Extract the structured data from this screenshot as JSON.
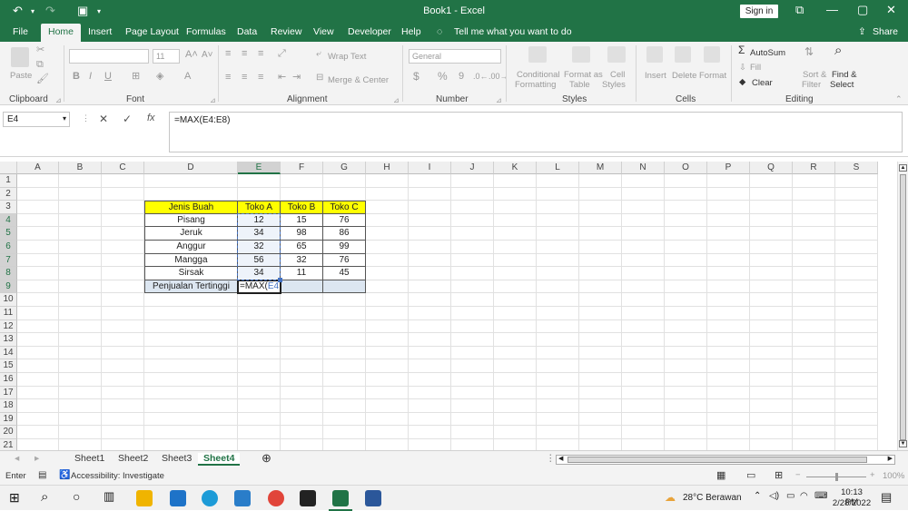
{
  "window": {
    "title": "Book1 - Excel",
    "signin": "Sign in"
  },
  "tabs": [
    "File",
    "Home",
    "Insert",
    "Page Layout",
    "Formulas",
    "Data",
    "Review",
    "View",
    "Developer",
    "Help"
  ],
  "tell_me": "Tell me what you want to do",
  "share": "Share",
  "ribbon": {
    "clipboard": {
      "label": "Clipboard",
      "paste": "Paste"
    },
    "font": {
      "label": "Font",
      "size": "11"
    },
    "alignment": {
      "label": "Alignment",
      "wrap": "Wrap Text",
      "merge": "Merge & Center"
    },
    "number": {
      "label": "Number",
      "format": "General"
    },
    "styles": {
      "label": "Styles",
      "conditional1": "Conditional",
      "conditional2": "Formatting",
      "format_as1": "Format as",
      "format_as2": "Table",
      "cell1": "Cell",
      "cell2": "Styles"
    },
    "cells": {
      "label": "Cells",
      "insert": "Insert",
      "delete": "Delete",
      "format": "Format"
    },
    "editing": {
      "label": "Editing",
      "autosum": "AutoSum",
      "fill": "Fill",
      "clear": "Clear",
      "sort1": "Sort &",
      "sort2": "Filter",
      "find1": "Find &",
      "find2": "Select"
    }
  },
  "formula_bar": {
    "name_box": "E4",
    "formula": "=MAX(E4:E8)"
  },
  "columns": [
    "A",
    "B",
    "C",
    "D",
    "E",
    "F",
    "G",
    "H",
    "I",
    "J",
    "K",
    "L",
    "M",
    "N",
    "O",
    "P",
    "Q",
    "R",
    "S"
  ],
  "rows": [
    "1",
    "2",
    "3",
    "4",
    "5",
    "6",
    "7",
    "8",
    "9",
    "10",
    "11",
    "12",
    "13",
    "14",
    "15",
    "16",
    "17",
    "18",
    "19",
    "20",
    "21"
  ],
  "table": {
    "headers": [
      "Jenis Buah",
      "Toko A",
      "Toko B",
      "Toko C"
    ],
    "rows": [
      [
        "Pisang",
        "12",
        "15",
        "76"
      ],
      [
        "Jeruk",
        "34",
        "98",
        "86"
      ],
      [
        "Anggur",
        "32",
        "65",
        "99"
      ],
      [
        "Mangga",
        "56",
        "32",
        "76"
      ],
      [
        "Sirsak",
        "34",
        "11",
        "45"
      ]
    ],
    "footer_label": "Penjualan Tertinggi",
    "footer_prefix": "=MAX(",
    "footer_ref": "E4:E8",
    "footer_suffix": ")"
  },
  "sheets": [
    "Sheet1",
    "Sheet2",
    "Sheet3",
    "Sheet4"
  ],
  "status": {
    "mode": "Enter",
    "accessibility": "Accessibility: Investigate",
    "zoom": "100%"
  },
  "taskbar": {
    "weather": "28°C  Berawan",
    "time": "10:13 PM",
    "date": "2/28/2022"
  },
  "colors": {
    "excel_green": "#217346",
    "header_fill": "#ffff00",
    "footer_fill": "#dce6f1",
    "ref_blue": "#4472c4"
  }
}
